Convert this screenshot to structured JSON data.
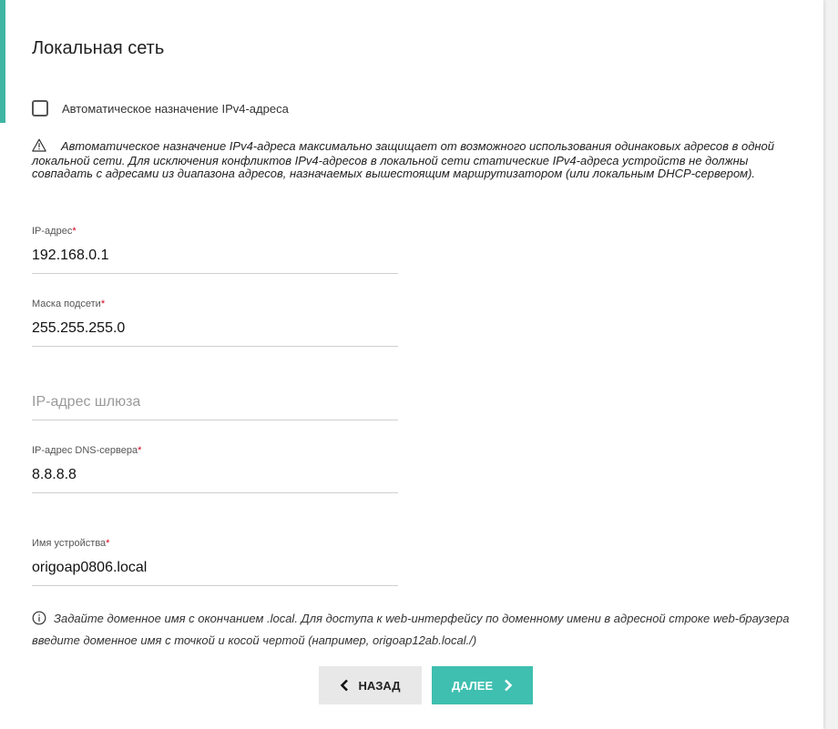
{
  "page": {
    "title": "Локальная сеть",
    "accent_color": "#3fb5a3"
  },
  "auto_ipv4": {
    "label": "Автоматическое назначение IPv4-адреса",
    "checked": false
  },
  "warning": {
    "icon": "warning-triangle-icon",
    "text": "Автоматическое назначение IPv4-адреса максимально защищает от возможного использования одинаковых адресов в одной локальной сети. Для исключения конфликтов IPv4-адресов в локальной сети статические IPv4-адреса устройств не должны совпадать с адресами из диапазона адресов, назначаемых вышестоящим маршрутизатором (или локальным DHCP-сервером)."
  },
  "fields": {
    "ip": {
      "label": "IP-адрес",
      "required": "*",
      "value": "192.168.0.1"
    },
    "mask": {
      "label": "Маска подсети",
      "required": "*",
      "value": "255.255.255.0"
    },
    "gateway": {
      "placeholder": "IP-адрес шлюза",
      "value": ""
    },
    "dns": {
      "label": "IP-адрес DNS-сервера",
      "required": "*",
      "value": "8.8.8.8"
    },
    "device_name": {
      "label": "Имя устройства",
      "required": "*",
      "value": "origoap0806.local"
    }
  },
  "info": {
    "icon": "info-circle-icon",
    "text": "Задайте доменное имя с окончанием .local. Для доступа к web-интерфейсу по доменному имени в адресной строке web-браузера введите доменное имя с точкой и косой чертой (например, origoap12ab.local./)"
  },
  "buttons": {
    "back_label": "НАЗАД",
    "next_label": "ДАЛЕЕ",
    "next_color": "#3fbfb0"
  }
}
